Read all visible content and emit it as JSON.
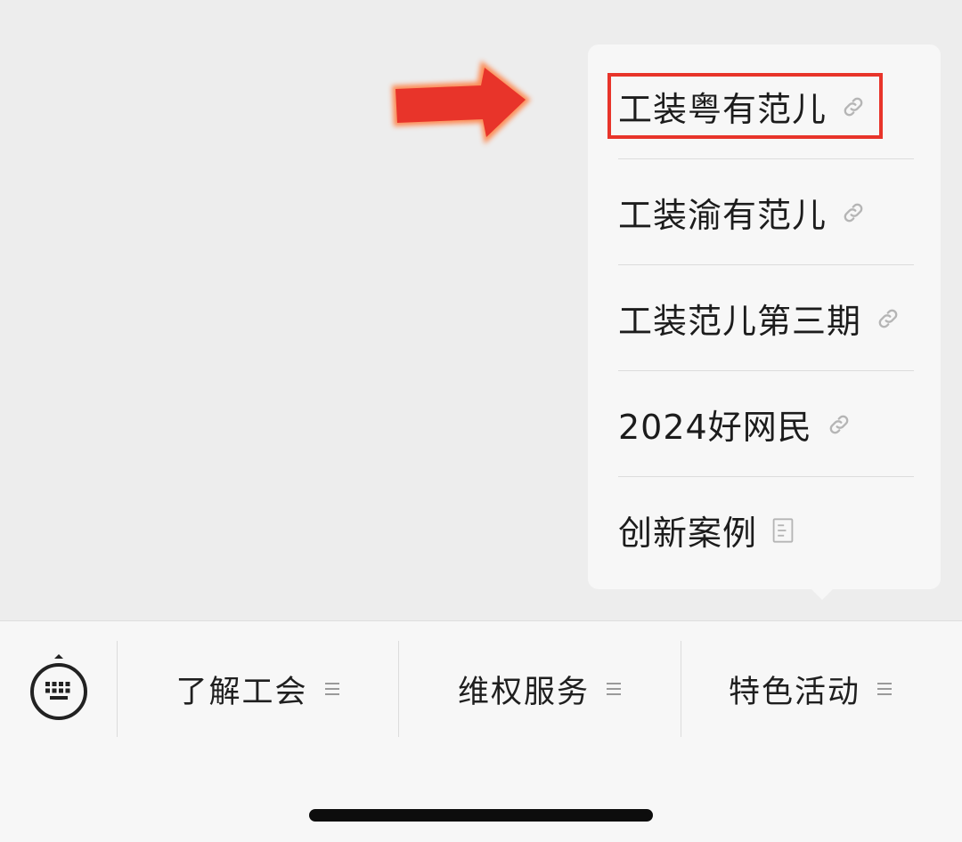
{
  "popup_menu": {
    "items": [
      {
        "label": "工装粤有范儿",
        "icon": "link-icon"
      },
      {
        "label": "工装渝有范儿",
        "icon": "link-icon"
      },
      {
        "label": "工装范儿第三期",
        "icon": "link-icon"
      },
      {
        "label": "2024好网民",
        "icon": "link-icon"
      },
      {
        "label": "创新案例",
        "icon": "article-icon"
      }
    ]
  },
  "bottom_menu": {
    "keyboard_icon": "keyboard-icon",
    "tabs": [
      {
        "label": "了解工会",
        "icon": "menu-lines-icon"
      },
      {
        "label": "维权服务",
        "icon": "menu-lines-icon"
      },
      {
        "label": "特色活动",
        "icon": "menu-lines-icon"
      }
    ]
  },
  "annotations": {
    "arrow_color": "#e8342a",
    "highlight_color": "#e8342a"
  }
}
